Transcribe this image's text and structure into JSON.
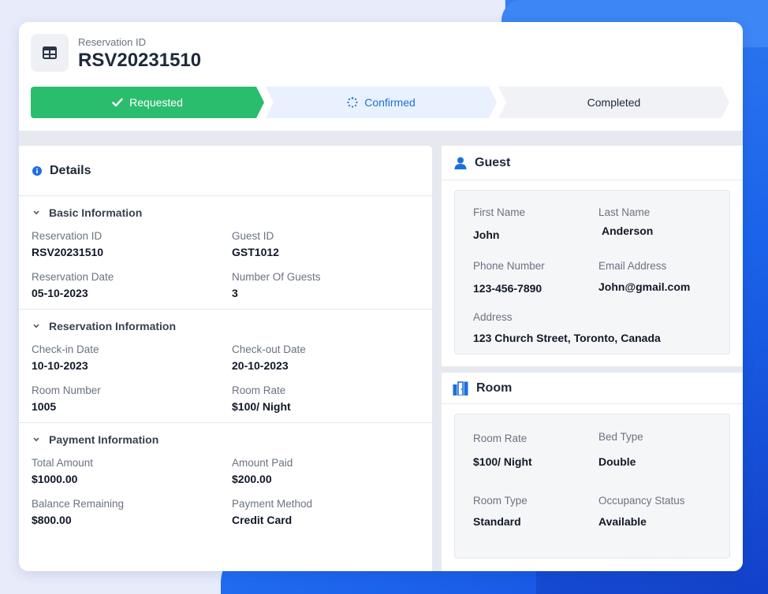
{
  "header": {
    "reservation_label": "Reservation ID",
    "reservation_id": "RSV20231510",
    "steps": [
      {
        "label": "Requested",
        "status": "done"
      },
      {
        "label": "Confirmed",
        "status": "in-progress"
      },
      {
        "label": "Completed",
        "status": "pending"
      }
    ]
  },
  "details": {
    "title": "Details",
    "sections": [
      {
        "title": "Basic Information",
        "fields": [
          {
            "label": "Reservation ID",
            "value": "RSV20231510"
          },
          {
            "label": "Guest ID",
            "value": "GST1012"
          },
          {
            "label": "Reservation Date",
            "value": "05-10-2023"
          },
          {
            "label": "Number Of Guests",
            "value": "3"
          }
        ]
      },
      {
        "title": "Reservation Information",
        "fields": [
          {
            "label": "Check-in Date",
            "value": "10-10-2023"
          },
          {
            "label": "Check-out Date",
            "value": "20-10-2023"
          },
          {
            "label": "Room Number",
            "value": "1005"
          },
          {
            "label": "Room Rate",
            "value": "$100/ Night"
          }
        ]
      },
      {
        "title": "Payment Information",
        "fields": [
          {
            "label": "Total Amount",
            "value": "$1000.00"
          },
          {
            "label": "Amount Paid",
            "value": "$200.00"
          },
          {
            "label": "Balance Remaining",
            "value": "$800.00"
          },
          {
            "label": "Payment Method",
            "value": "Credit Card"
          }
        ]
      }
    ]
  },
  "guest": {
    "title": "Guest",
    "first_name_label": "First Name",
    "first_name": "John",
    "last_name_label": "Last Name",
    "last_name": "Anderson",
    "phone_label": "Phone Number",
    "phone": "123-456-7890",
    "email_label": "Email Address",
    "email": "John@gmail.com",
    "address_label": "Address",
    "address": "123 Church Street, Toronto, Canada"
  },
  "room": {
    "title": "Room",
    "rate_label": "Room Rate",
    "rate": "$100/ Night",
    "bed_label": "Bed Type",
    "bed": "Double",
    "type_label": "Room Type",
    "type": "Standard",
    "occupancy_label": "Occupancy Status",
    "occupancy": "Available"
  },
  "colors": {
    "success": "#2bbd6e",
    "primary": "#1d6fe0",
    "background_blue": "#1a63ea"
  }
}
